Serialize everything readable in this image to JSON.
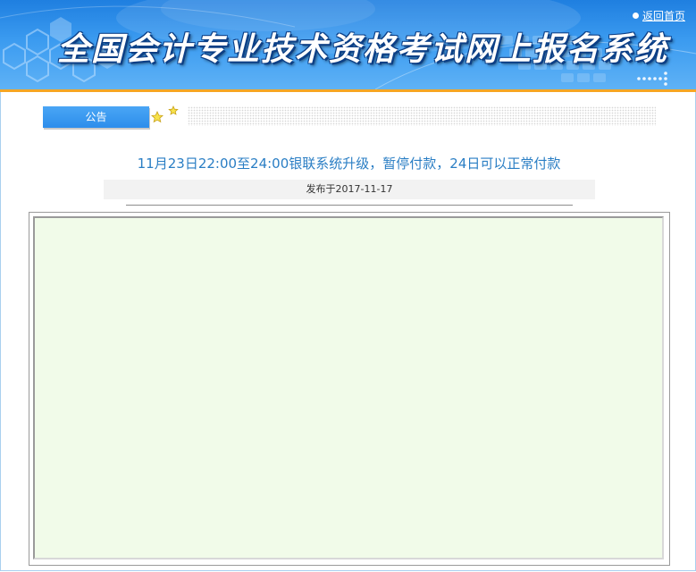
{
  "header": {
    "title": "全国会计专业技术资格考试网上报名系统",
    "home_link": "返回首页"
  },
  "notice": {
    "tab_label": "公告",
    "title": "11月23日22:00至24:00银联系统升级，暂停付款，24日可以正常付款",
    "publish_info": "发布于2017-11-17",
    "body_text": ""
  },
  "colors": {
    "header_blue": "#2f8ee8",
    "accent_orange": "#f6a623",
    "tab_blue": "#2c8deb",
    "title_text": "#2a7ec4",
    "body_bg": "#f1fbe9"
  },
  "icons": {
    "star": "star-icon",
    "bullet": "bullet-dot-icon"
  }
}
